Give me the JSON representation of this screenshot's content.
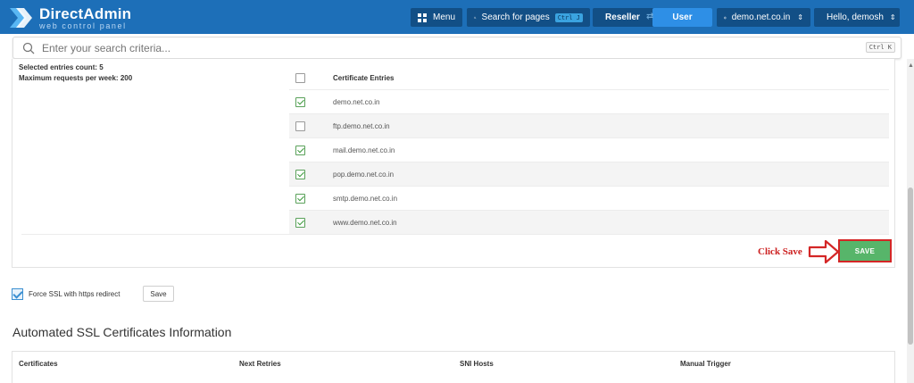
{
  "app": {
    "brand": "DirectAdmin",
    "brand_sub": "web control panel"
  },
  "header": {
    "menu_label": "Menu",
    "search_pages_label": "Search for pages",
    "search_pages_shortcut": "Ctrl J",
    "reseller_label": "Reseller",
    "user_label": "User",
    "domain_label": "demo.net.co.in",
    "greeting": "Hello, demosh",
    "active_mode": "User"
  },
  "search": {
    "placeholder": "Enter your search criteria...",
    "shortcut": "Ctrl K"
  },
  "stats": {
    "selected_count": "Selected entries count: 5",
    "max_requests": "Maximum requests per week: 200"
  },
  "certificates": {
    "header": "Certificate Entries",
    "entries": [
      {
        "name": "demo.net.co.in",
        "checked": true
      },
      {
        "name": "ftp.demo.net.co.in",
        "checked": false
      },
      {
        "name": "mail.demo.net.co.in",
        "checked": true
      },
      {
        "name": "pop.demo.net.co.in",
        "checked": true
      },
      {
        "name": "smtp.demo.net.co.in",
        "checked": true
      },
      {
        "name": "www.demo.net.co.in",
        "checked": true
      }
    ]
  },
  "annotation": {
    "click_save": "Click Save"
  },
  "actions": {
    "save_label": "SAVE",
    "small_save_label": "Save"
  },
  "force_ssl": {
    "label": "Force SSL with https redirect",
    "checked": true
  },
  "automated": {
    "title": "Automated SSL Certificates Information",
    "columns": [
      "Certificates",
      "Next Retries",
      "SNI Hosts",
      "Manual Trigger"
    ]
  },
  "colors": {
    "header_bg": "#1d6fb8",
    "header_btn": "#124f86",
    "user_active": "#2e8fe6",
    "save_green": "#57b56a",
    "annotation_red": "#cc1f1f"
  }
}
